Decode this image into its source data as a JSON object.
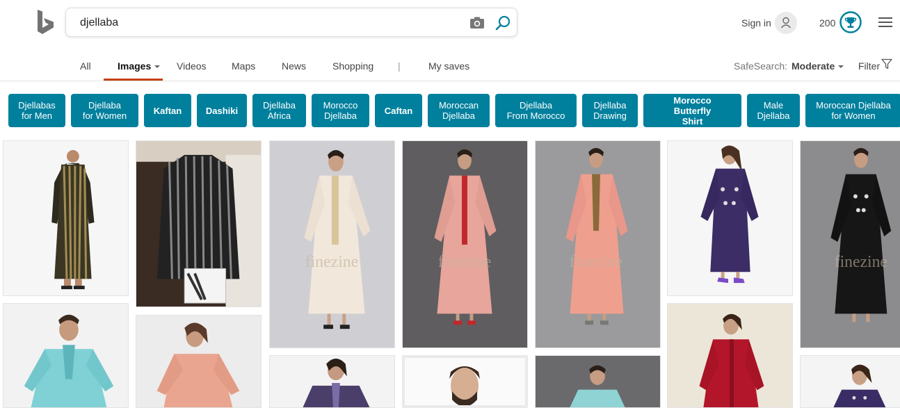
{
  "header": {
    "logo_icon": "bing-logo-icon",
    "search_value": "djellaba",
    "sign_in_label": "Sign in",
    "points": "200"
  },
  "nav": {
    "items": [
      "All",
      "Images",
      "Videos",
      "Maps",
      "News",
      "Shopping",
      "|",
      "My saves"
    ],
    "active": "Images",
    "safesearch_label": "SafeSearch:",
    "safesearch_value": "Moderate",
    "filter_label": "Filter"
  },
  "related": [
    "Djellabas\nfor Men",
    "Djellaba\nfor Women",
    "Kaftan",
    "Dashiki",
    "Djellaba\nAfrica",
    "Morocco\nDjellaba",
    "Caftan",
    "Moroccan\nDjellaba",
    "Djellaba\nFrom Morocco",
    "Djellaba\nDrawing",
    "Morocco Butterfly\nShirt",
    "Male\nDjellaba",
    "Moroccan Djellaba\nfor Women"
  ],
  "watermark": "finezine",
  "colors": {
    "accent": "#00809d",
    "active_underline": "#c4400d"
  }
}
